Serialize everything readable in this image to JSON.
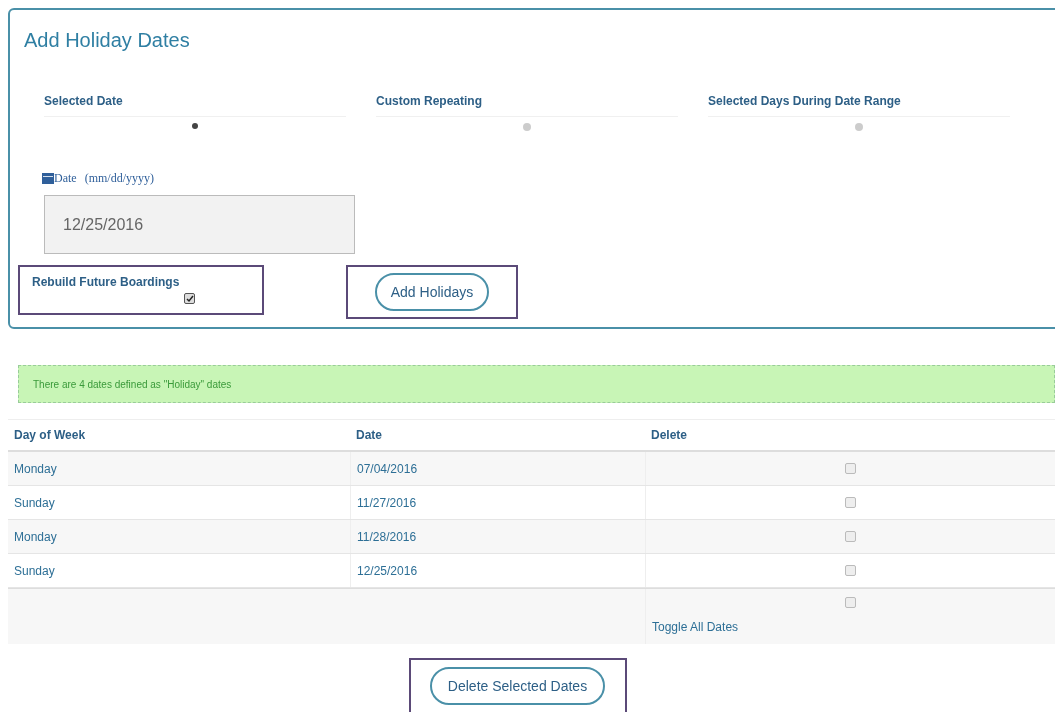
{
  "panel": {
    "title": "Add Holiday Dates",
    "steps": [
      {
        "label": "Selected Date",
        "selected": true
      },
      {
        "label": "Custom Repeating",
        "selected": false
      },
      {
        "label": "Selected Days During Date Range",
        "selected": false
      }
    ],
    "date_field": {
      "label": "Date",
      "hint": "(mm/dd/yyyy)",
      "value": "12/25/2016"
    },
    "rebuild": {
      "label": "Rebuild Future Boardings",
      "checked": true
    },
    "add_button": "Add Holidays"
  },
  "banner": "There are 4 dates defined as \"Holiday\" dates",
  "table": {
    "columns": [
      "Day of Week",
      "Date",
      "Delete"
    ],
    "rows": [
      {
        "day": "Monday",
        "date": "07/04/2016",
        "checked": false
      },
      {
        "day": "Sunday",
        "date": "11/27/2016",
        "checked": false
      },
      {
        "day": "Monday",
        "date": "11/28/2016",
        "checked": false
      },
      {
        "day": "Sunday",
        "date": "12/25/2016",
        "checked": false
      }
    ],
    "toggle": {
      "label": "Toggle All Dates",
      "checked": false
    }
  },
  "delete_button": "Delete Selected Dates"
}
